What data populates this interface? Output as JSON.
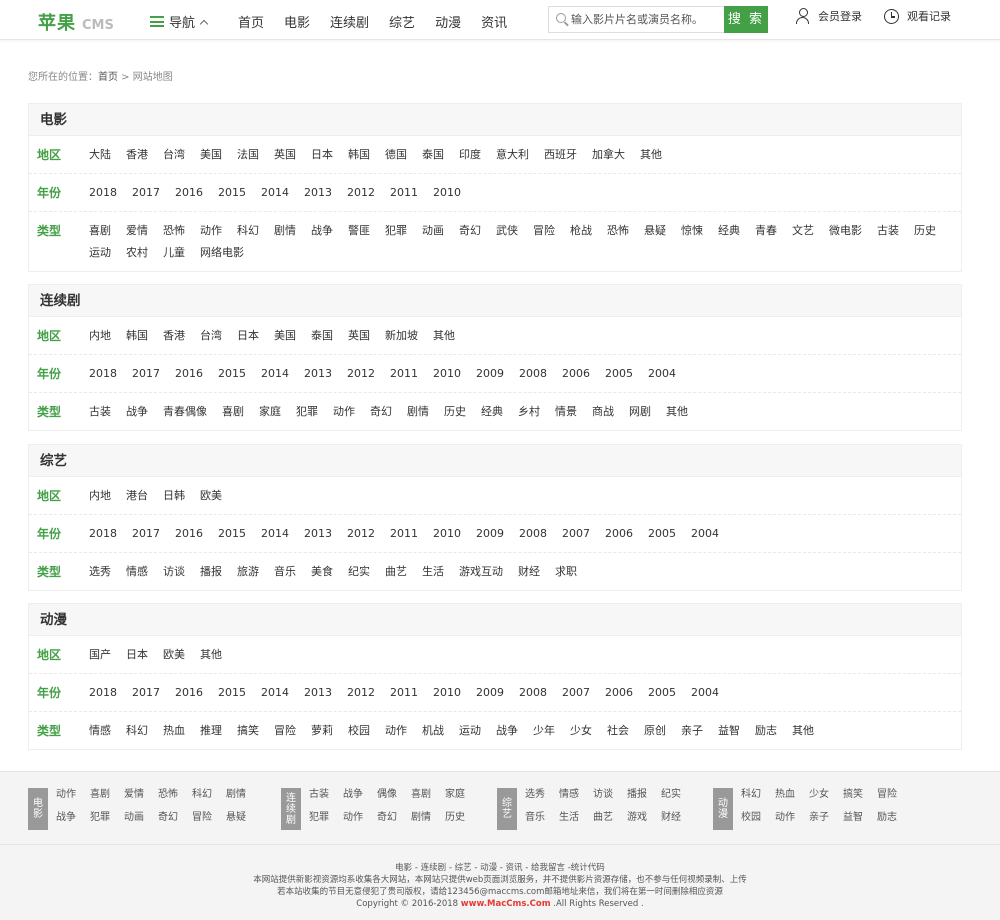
{
  "header": {
    "logo": "苹果",
    "logo_suffix": "CMS",
    "nav_label": "导航",
    "menu": [
      "首页",
      "电影",
      "连续剧",
      "综艺",
      "动漫",
      "资讯"
    ],
    "search_placeholder": "输入影片片名或演员名称。",
    "search_button": "搜 索",
    "login": "会员登录",
    "history": "观看记录"
  },
  "breadcrumb": {
    "prefix": "您所在的位置：",
    "home": "首页",
    "sep": " > ",
    "current": "网站地图"
  },
  "sections": [
    {
      "title": "电影",
      "rows": [
        {
          "label": "地区",
          "items": [
            "大陆",
            "香港",
            "台湾",
            "美国",
            "法国",
            "英国",
            "日本",
            "韩国",
            "德国",
            "泰国",
            "印度",
            "意大利",
            "西班牙",
            "加拿大",
            "其他"
          ]
        },
        {
          "label": "年份",
          "items": [
            "2018",
            "2017",
            "2016",
            "2015",
            "2014",
            "2013",
            "2012",
            "2011",
            "2010"
          ]
        },
        {
          "label": "类型",
          "items": [
            "喜剧",
            "爱情",
            "恐怖",
            "动作",
            "科幻",
            "剧情",
            "战争",
            "警匪",
            "犯罪",
            "动画",
            "奇幻",
            "武侠",
            "冒险",
            "枪战",
            "恐怖",
            "悬疑",
            "惊悚",
            "经典",
            "青春",
            "文艺",
            "微电影",
            "古装",
            "历史",
            "运动",
            "农村",
            "儿童",
            "网络电影"
          ]
        }
      ]
    },
    {
      "title": "连续剧",
      "rows": [
        {
          "label": "地区",
          "items": [
            "内地",
            "韩国",
            "香港",
            "台湾",
            "日本",
            "美国",
            "泰国",
            "英国",
            "新加坡",
            "其他"
          ]
        },
        {
          "label": "年份",
          "items": [
            "2018",
            "2017",
            "2016",
            "2015",
            "2014",
            "2013",
            "2012",
            "2011",
            "2010",
            "2009",
            "2008",
            "2006",
            "2005",
            "2004"
          ]
        },
        {
          "label": "类型",
          "items": [
            "古装",
            "战争",
            "青春偶像",
            "喜剧",
            "家庭",
            "犯罪",
            "动作",
            "奇幻",
            "剧情",
            "历史",
            "经典",
            "乡村",
            "情景",
            "商战",
            "网剧",
            "其他"
          ]
        }
      ]
    },
    {
      "title": "综艺",
      "rows": [
        {
          "label": "地区",
          "items": [
            "内地",
            "港台",
            "日韩",
            "欧美"
          ]
        },
        {
          "label": "年份",
          "items": [
            "2018",
            "2017",
            "2016",
            "2015",
            "2014",
            "2013",
            "2012",
            "2011",
            "2010",
            "2009",
            "2008",
            "2007",
            "2006",
            "2005",
            "2004"
          ]
        },
        {
          "label": "类型",
          "items": [
            "选秀",
            "情感",
            "访谈",
            "播报",
            "旅游",
            "音乐",
            "美食",
            "纪实",
            "曲艺",
            "生活",
            "游戏互动",
            "财经",
            "求职"
          ]
        }
      ]
    },
    {
      "title": "动漫",
      "rows": [
        {
          "label": "地区",
          "items": [
            "国产",
            "日本",
            "欧美",
            "其他"
          ]
        },
        {
          "label": "年份",
          "items": [
            "2018",
            "2017",
            "2016",
            "2015",
            "2014",
            "2013",
            "2012",
            "2011",
            "2010",
            "2009",
            "2008",
            "2007",
            "2006",
            "2005",
            "2004"
          ]
        },
        {
          "label": "类型",
          "items": [
            "情感",
            "科幻",
            "热血",
            "推理",
            "搞笑",
            "冒险",
            "萝莉",
            "校园",
            "动作",
            "机战",
            "运动",
            "战争",
            "少年",
            "少女",
            "社会",
            "原创",
            "亲子",
            "益智",
            "励志",
            "其他"
          ]
        }
      ]
    }
  ],
  "footer": {
    "groups": [
      {
        "badge": "电影",
        "links": [
          "动作",
          "喜剧",
          "爱情",
          "恐怖",
          "科幻",
          "剧情",
          "战争",
          "犯罪",
          "动画",
          "奇幻",
          "冒险",
          "悬疑"
        ]
      },
      {
        "badge": "连续剧",
        "links": [
          "古装",
          "战争",
          "偶像",
          "喜剧",
          "家庭",
          "犯罪",
          "动作",
          "奇幻",
          "剧情",
          "历史"
        ]
      },
      {
        "badge": "综艺",
        "links": [
          "选秀",
          "情感",
          "访谈",
          "播报",
          "纪实",
          "音乐",
          "生活",
          "曲艺",
          "游戏",
          "财经"
        ]
      },
      {
        "badge": "动漫",
        "links": [
          "科幻",
          "热血",
          "少女",
          "搞笑",
          "冒险",
          "校园",
          "动作",
          "亲子",
          "益智",
          "励志"
        ]
      }
    ],
    "links_line": "电影 - 连续剧 - 综艺 - 动漫 - 资讯 - 给我留言 -统计代码",
    "notice_line1": "本网站提供新影视资源均系收集各大网站，本网站只提供web页面浏览服务，并不提供影片资源存储，也不参与任何视频录制、上传",
    "notice_line2": "若本站收集的节目无意侵犯了贵司版权，请给123456@maccms.com邮箱地址来信，我们将在第一时间删除相应资源",
    "copyright_prefix": "Copyright © 2016-2018",
    "copyright_brand": "www.MacCms.Com",
    "copyright_suffix": ".All Rights Reserved ."
  }
}
